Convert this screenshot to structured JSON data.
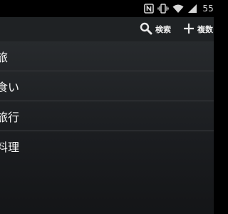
{
  "status_bar": {
    "icons": [
      "nfc-icon",
      "vibrate-icon",
      "wifi-icon",
      "signal-icon"
    ],
    "battery_text": "55"
  },
  "action_bar": {
    "search_label": "検索",
    "multi_label": "複数"
  },
  "list": {
    "items": [
      {
        "label": "旅"
      },
      {
        "label": "食い"
      },
      {
        "label": "旅行"
      },
      {
        "label": "料理"
      }
    ]
  }
}
